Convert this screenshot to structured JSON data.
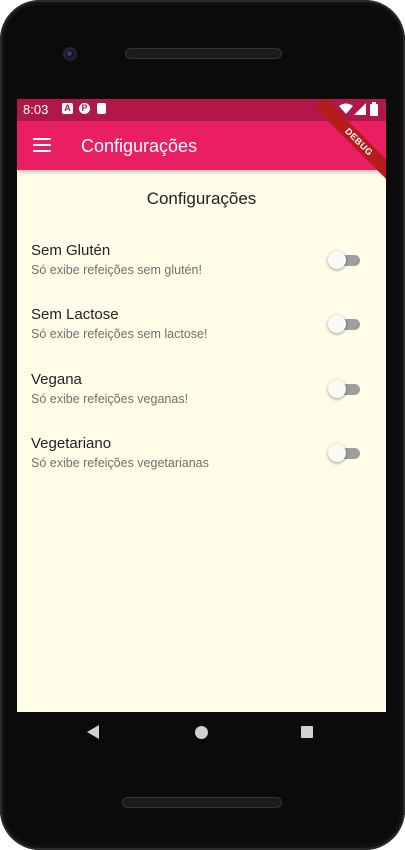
{
  "status_bar": {
    "time": "8:03",
    "icons": [
      "a-icon",
      "p-icon",
      "sd-card-icon",
      "wifi-icon",
      "signal-icon",
      "battery-icon"
    ]
  },
  "app_bar": {
    "title": "Configurações",
    "menu_icon": "hamburger-icon",
    "debug_banner": "DEBUG"
  },
  "page": {
    "title": "Configurações",
    "settings": [
      {
        "label": "Sem Glutén",
        "description": "Só exibe refeições sem glutén!",
        "enabled": false
      },
      {
        "label": "Sem Lactose",
        "description": "Só exibe refeições sem lactose!",
        "enabled": false
      },
      {
        "label": "Vegana",
        "description": "Só exibe refeições veganas!",
        "enabled": false
      },
      {
        "label": "Vegetariano",
        "description": "Só exibe refeições vegetarianas",
        "enabled": false
      }
    ]
  },
  "nav_bar": {
    "buttons": [
      "back-icon",
      "home-icon",
      "recents-icon"
    ]
  },
  "colors": {
    "primary": "#e91e63",
    "status_bar": "#b0184a",
    "background": "#fffde7"
  }
}
